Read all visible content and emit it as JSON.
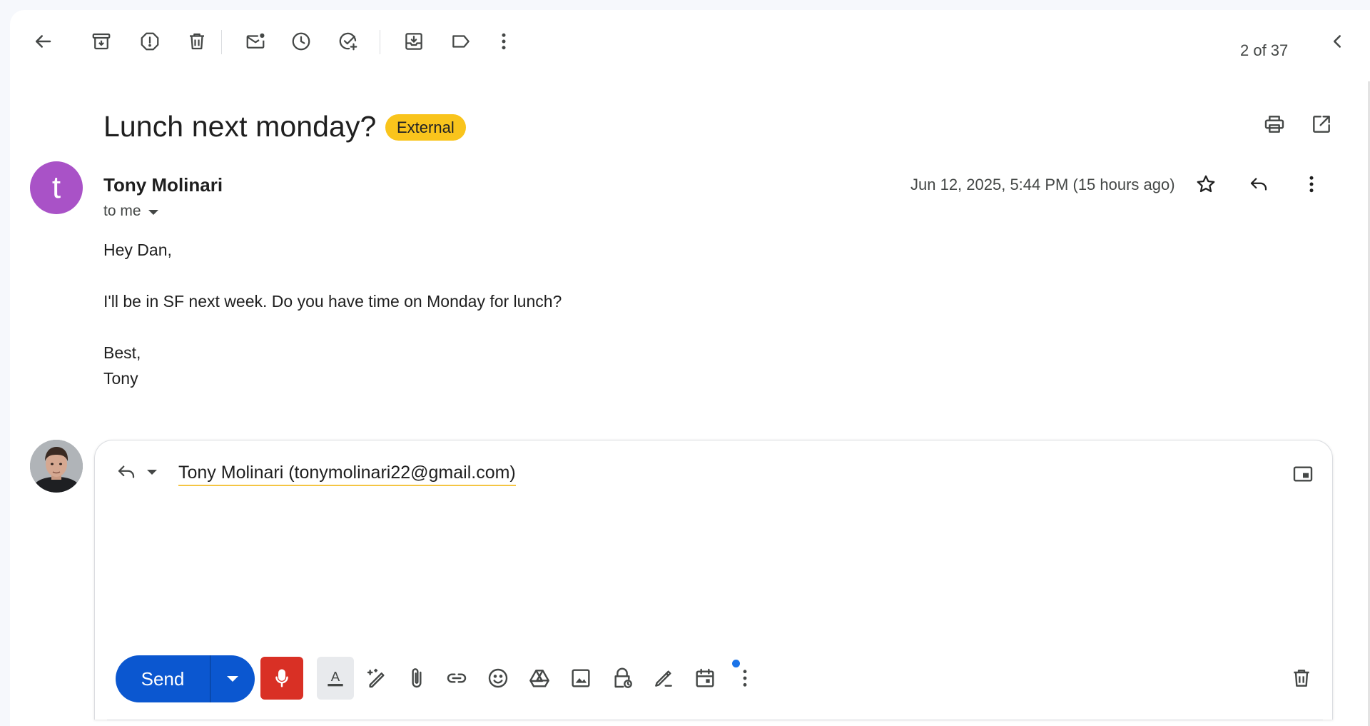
{
  "colors": {
    "accent": "#0b57d0",
    "badge": "#f9c41c",
    "avatar": "#a952c7",
    "mic": "#d93025",
    "notification_dot": "#1a73e8"
  },
  "toolbar": {
    "icons": [
      "back-arrow-icon",
      "archive-icon",
      "report-spam-icon",
      "delete-icon",
      "mark-unread-icon",
      "snooze-icon",
      "add-to-tasks-icon",
      "move-to-icon",
      "label-icon",
      "more-vert-icon"
    ],
    "pager": "2 of 37"
  },
  "email": {
    "subject": "Lunch next monday?",
    "badge": "External",
    "sender_initial": "t",
    "sender": "Tony Molinari",
    "to": "to me",
    "date": "Jun 12, 2025, 5:44 PM (15 hours ago)",
    "body": {
      "greeting": "Hey Dan,",
      "line1": "I'll be in SF next week. Do you have time on Monday for lunch?",
      "closing": "Best,",
      "signature": "Tony"
    }
  },
  "reply": {
    "recipient": "Tony Molinari (tonymolinari22@gmail.com)",
    "send_label": "Send",
    "format_icons": [
      "text-format-icon",
      "help-me-write-icon",
      "attach-icon",
      "link-icon",
      "emoji-icon",
      "drive-icon",
      "photo-icon",
      "confidential-icon",
      "signature-icon",
      "schedule-event-icon",
      "more-options-icon",
      "discard-icon"
    ]
  }
}
